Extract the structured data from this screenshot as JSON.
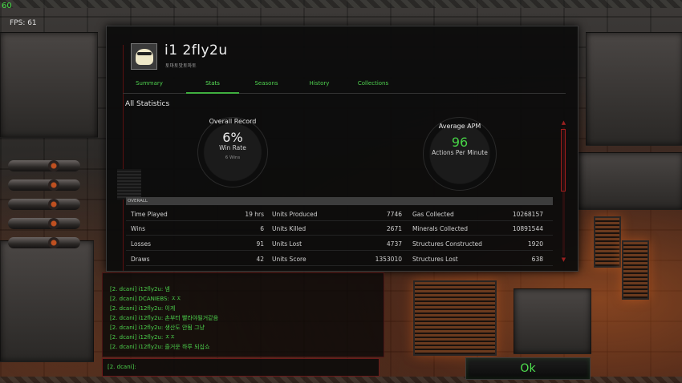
{
  "hud": {
    "fps_count": "60",
    "fps_label": "FPS: 61"
  },
  "profile": {
    "player_name": "i1 2fly2u",
    "clan_name": "토마토맛토마토",
    "avatar_icon": "avatar-portrait-icon"
  },
  "tabs": [
    {
      "label": "Summary",
      "active": false
    },
    {
      "label": "Stats",
      "active": true
    },
    {
      "label": "Seasons",
      "active": false
    },
    {
      "label": "History",
      "active": false
    },
    {
      "label": "Collections",
      "active": false
    }
  ],
  "section_title": "All Statistics",
  "overall_record": {
    "title": "Overall Record",
    "value": "6%",
    "label": "Win Rate",
    "sub": "6 Wins"
  },
  "average_apm": {
    "title": "Average APM",
    "value": "96",
    "label": "Actions Per Minute"
  },
  "overall_header": "OVERALL",
  "stats_rows": [
    [
      {
        "label": "Time Played",
        "value": "19 hrs"
      },
      {
        "label": "Units Produced",
        "value": "7746"
      },
      {
        "label": "Gas Collected",
        "value": "10268157"
      }
    ],
    [
      {
        "label": "Wins",
        "value": "6"
      },
      {
        "label": "Units Killed",
        "value": "2671"
      },
      {
        "label": "Minerals Collected",
        "value": "10891544"
      }
    ],
    [
      {
        "label": "Losses",
        "value": "91"
      },
      {
        "label": "Units Lost",
        "value": "4737"
      },
      {
        "label": "Structures Constructed",
        "value": "1920"
      }
    ],
    [
      {
        "label": "Draws",
        "value": "42"
      },
      {
        "label": "Units Score",
        "value": "1353010"
      },
      {
        "label": "Structures Lost",
        "value": "638"
      }
    ]
  ],
  "chat": {
    "lines": [
      "[2. dcani] i12fly2u: 넴",
      "[2. dcani] DCANIEBS: ㅈㅈ",
      "[2. dcani] i12fly2u: 이게",
      "[2. dcani] i12fly2u: 손부터 빨라야될거같음",
      "[2. dcani] i12fly2u: 생산도 안됨 그냥",
      "[2. dcani] i12fly2u: ㅈㅈ",
      "[2. dcani] i12fly2u: 즐거운 하루 되십쇼"
    ],
    "input_prompt": "[2. dcani]:"
  },
  "ok_label": "Ok",
  "colors": {
    "accent_green": "#46d246",
    "frame_red": "#a21d1d"
  }
}
